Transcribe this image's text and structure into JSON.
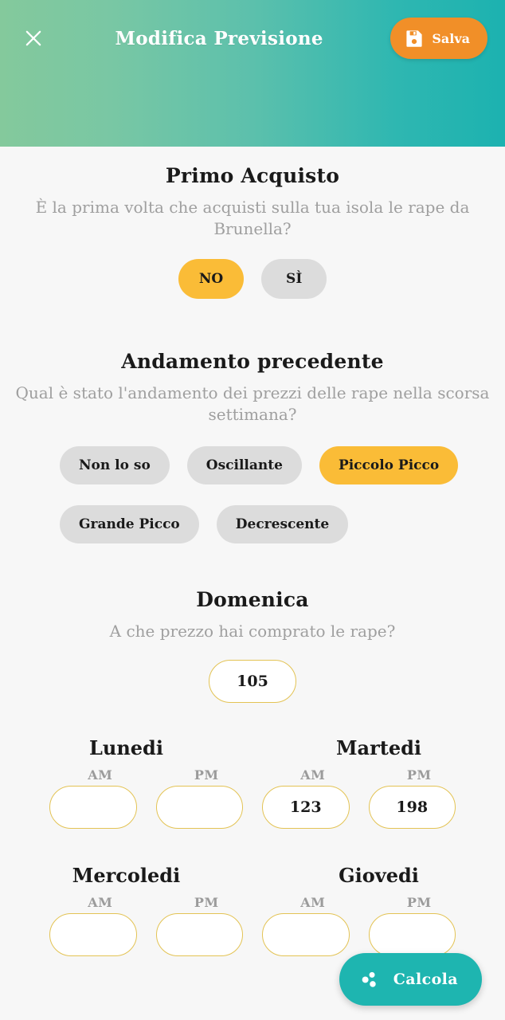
{
  "header": {
    "title": "Modifica Previsione",
    "close_icon": "close-icon",
    "save_label": "Salva",
    "save_icon": "floppy-disk-icon",
    "gradient_from": "#84c99c",
    "gradient_to": "#1cb2b0"
  },
  "theme": {
    "accent_amber": "#fabc37",
    "chip_gray": "#dcdcdc",
    "teal": "#1eb5b0",
    "orange": "#f18f28",
    "pill_border": "#e3c354",
    "background": "#f7f7f7",
    "muted_text": "#9f9f9f"
  },
  "sections": {
    "first_purchase": {
      "title": "Primo Acquisto",
      "question": "È la prima volta che acquisti sulla tua isola le rape da Brunella?",
      "options": [
        {
          "label": "NO",
          "selected": true
        },
        {
          "label": "SÌ",
          "selected": false
        }
      ]
    },
    "previous_pattern": {
      "title": "Andamento precedente",
      "question": "Qual è stato l'andamento dei prezzi delle rape nella scorsa settimana?",
      "row1": [
        {
          "label": "Non lo so",
          "selected": false
        },
        {
          "label": "Oscillante",
          "selected": false
        },
        {
          "label": "Piccolo Picco",
          "selected": true
        }
      ],
      "row2": [
        {
          "label": "Grande Picco",
          "selected": false
        },
        {
          "label": "Decrescente",
          "selected": false
        }
      ]
    },
    "sunday": {
      "title": "Domenica",
      "question": "A che prezzo hai comprato le rape?",
      "price": "105",
      "placeholder": ""
    },
    "days": [
      {
        "name": "Lunedi",
        "slots": [
          {
            "label": "AM",
            "value": ""
          },
          {
            "label": "PM",
            "value": ""
          }
        ]
      },
      {
        "name": "Martedi",
        "slots": [
          {
            "label": "AM",
            "value": "123"
          },
          {
            "label": "PM",
            "value": "198"
          }
        ]
      },
      {
        "name": "Mercoledi",
        "slots": [
          {
            "label": "AM",
            "value": ""
          },
          {
            "label": "PM",
            "value": ""
          }
        ]
      },
      {
        "name": "Giovedi",
        "slots": [
          {
            "label": "AM",
            "value": ""
          },
          {
            "label": "PM",
            "value": ""
          }
        ]
      }
    ]
  },
  "fab": {
    "label": "Calcola",
    "icon": "bubbles-chart-icon"
  }
}
